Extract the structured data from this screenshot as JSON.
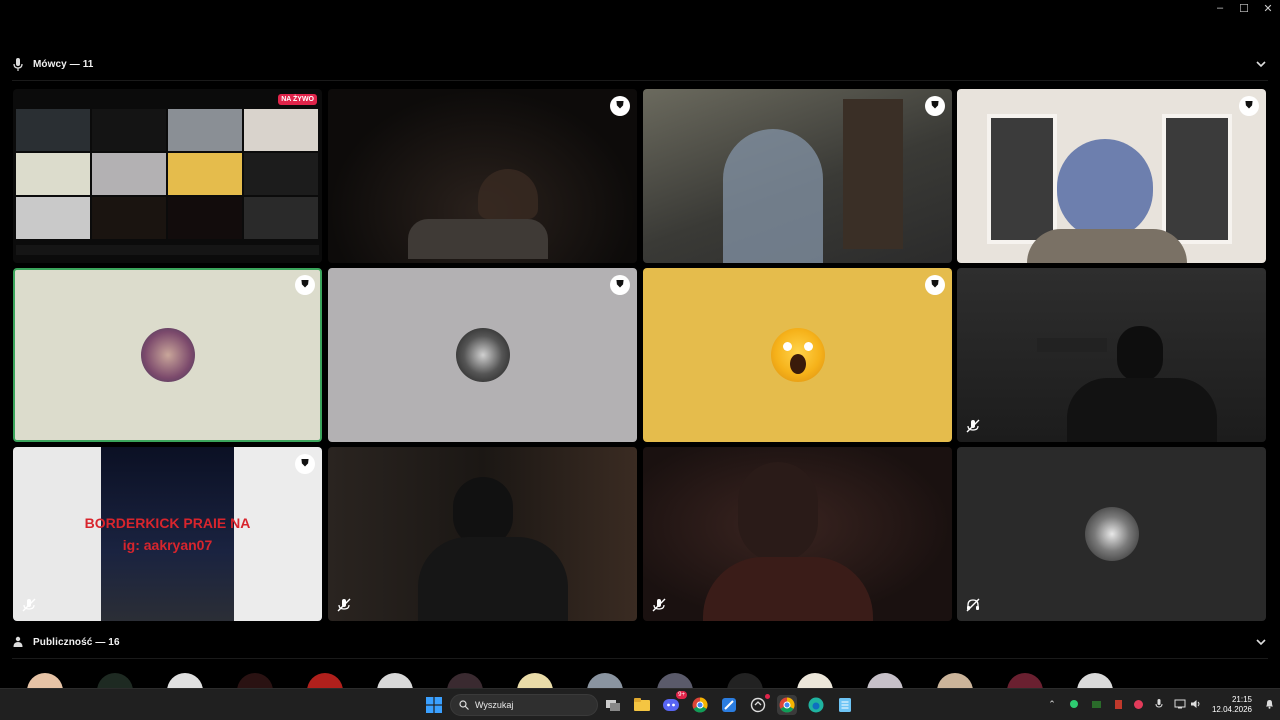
{
  "window": {
    "minimize": "–",
    "maximize": "☐",
    "close": "✕"
  },
  "speakers": {
    "title": "Mówcy — 11"
  },
  "audience": {
    "title": "Publiczność — 16"
  },
  "tiles": {
    "live_badge": "NA ŻYWO",
    "overlay_line1": "BORDERKICK PRAIE NA",
    "overlay_line2": "ig: aakryan07"
  },
  "taskbar": {
    "search_placeholder": "Wyszukaj",
    "time": "21:15",
    "date": "12.04.2026",
    "discord_badge": "9+"
  },
  "colors": {
    "tile_green": "#dcdccc",
    "tile_gray": "#b3b1b3",
    "tile_yellow": "#e5bc4c",
    "tile_dark": "#2a2a2a",
    "speaking_border": "#3ba55c"
  }
}
